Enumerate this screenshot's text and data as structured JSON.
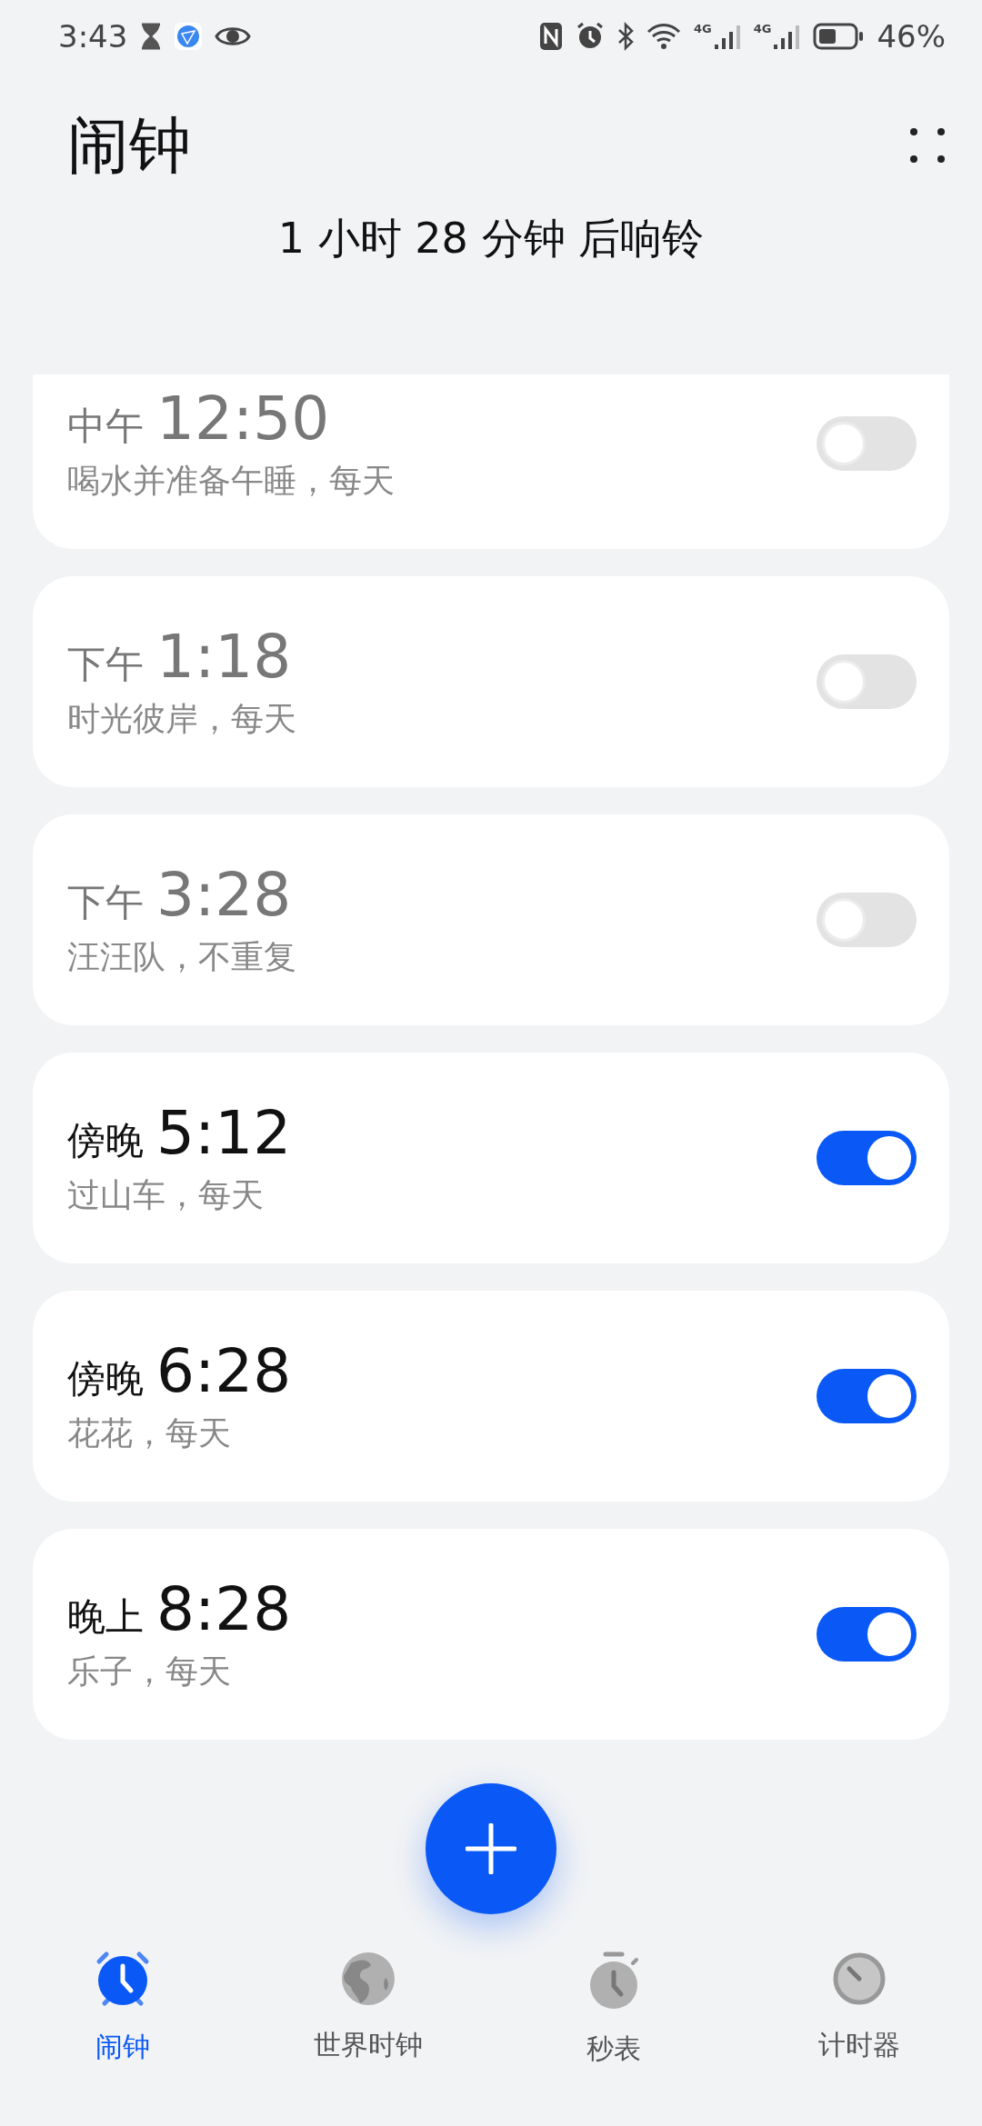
{
  "status_bar": {
    "time": "3:43",
    "network_labels": [
      "4G",
      "4G"
    ],
    "battery": "46%"
  },
  "header": {
    "title": "闹钟",
    "next_ring": "1 小时 28 分钟 后响铃"
  },
  "alarms": [
    {
      "period": "中午",
      "time": "12:50",
      "label": "喝水并准备午睡，每天",
      "on": false
    },
    {
      "period": "下午",
      "time": "1:18",
      "label": "时光彼岸，每天",
      "on": false
    },
    {
      "period": "下午",
      "time": "3:28",
      "label": "汪汪队，不重复",
      "on": false
    },
    {
      "period": "傍晚",
      "time": "5:12",
      "label": "过山车，每天",
      "on": true
    },
    {
      "period": "傍晚",
      "time": "6:28",
      "label": "花花，每天",
      "on": true
    },
    {
      "period": "晚上",
      "time": "8:28",
      "label": "乐子，每天",
      "on": true
    }
  ],
  "nav": [
    {
      "kind": "alarm",
      "label": "闹钟",
      "selected": true
    },
    {
      "kind": "world",
      "label": "世界时钟",
      "selected": false
    },
    {
      "kind": "stopwatch",
      "label": "秒表",
      "selected": false
    },
    {
      "kind": "timer",
      "label": "计时器",
      "selected": false
    }
  ]
}
